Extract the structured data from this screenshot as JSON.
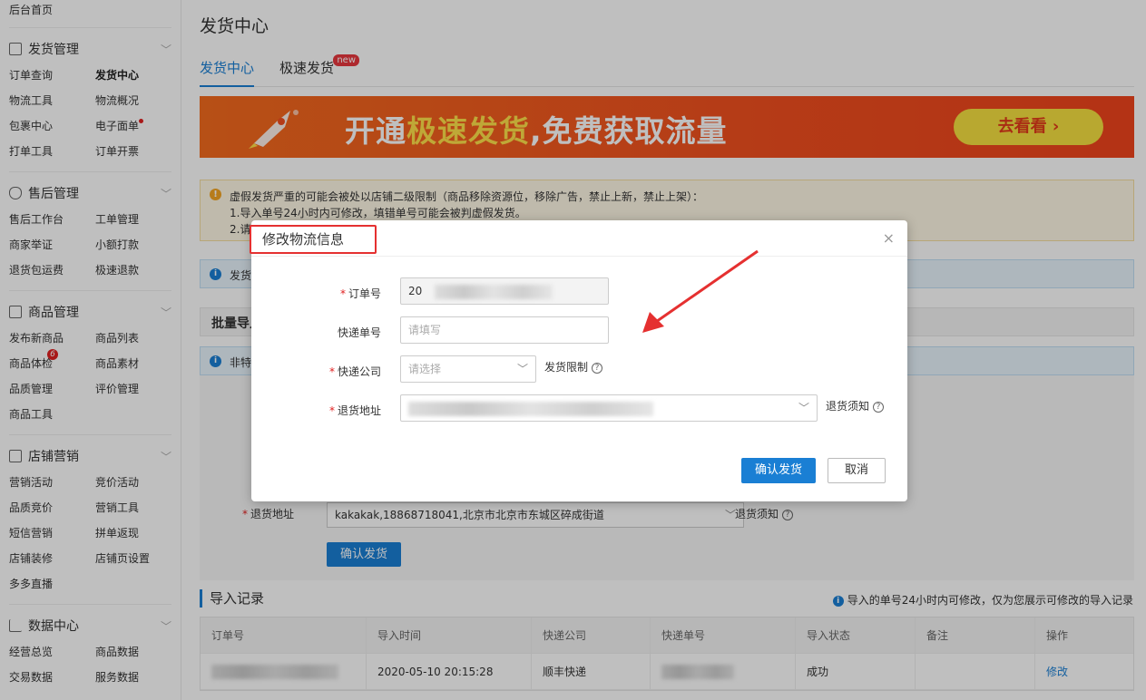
{
  "sidebar": {
    "top_item": "后台首页",
    "sections": [
      {
        "title": "发货管理",
        "items": [
          "订单查询",
          "发货中心",
          "物流工具",
          "物流概况",
          "包裹中心",
          "电子面单",
          "打单工具",
          "订单开票"
        ]
      },
      {
        "title": "售后管理",
        "items": [
          "售后工作台",
          "工单管理",
          "商家举证",
          "小额打款",
          "退货包运费",
          "极速退款"
        ]
      },
      {
        "title": "商品管理",
        "items": [
          "发布新商品",
          "商品列表",
          "商品体检",
          "商品素材",
          "品质管理",
          "评价管理",
          "商品工具"
        ],
        "badge": "6"
      },
      {
        "title": "店铺营销",
        "items": [
          "营销活动",
          "竞价活动",
          "品质竞价",
          "营销工具",
          "短信营销",
          "拼单返现",
          "店铺装修",
          "店铺页设置",
          "多多直播"
        ]
      },
      {
        "title": "数据中心",
        "items": [
          "经营总览",
          "商品数据",
          "交易数据",
          "服务数据"
        ]
      }
    ]
  },
  "page": {
    "title": "发货中心",
    "tabs": [
      "发货中心",
      "极速发货"
    ],
    "new_tag": "new"
  },
  "banner": {
    "text_a": "开通",
    "text_b": "极速发货",
    "text_c": ",免费获取流量",
    "button": "去看看 ›"
  },
  "warning": {
    "line1": "虚假发货严重的可能会被处以店铺二级限制（商品移除资源位，移除广告，禁止上新，禁止上架）：",
    "line2": "1.导入单号24小时内可修改，填错单号可能会被判虚假发货。",
    "line3": "2.请"
  },
  "info_bars": {
    "first": "发货",
    "second": "非特"
  },
  "batch_import": "批量导入",
  "bg_form": {
    "address_label": "退货地址",
    "address_value": "kakakak,18868718041,北京市北京市东城区碎成街道",
    "address_help": "退货须知",
    "confirm": "确认发货"
  },
  "records": {
    "title": "导入记录",
    "note": "导入的单号24小时内可修改，仅为您展示可修改的导入记录",
    "columns": [
      "订单号",
      "导入时间",
      "快递公司",
      "快递单号",
      "导入状态",
      "备注",
      "操作"
    ],
    "rows": [
      {
        "order": "",
        "time": "2020-05-10 20:15:28",
        "company": "顺丰快递",
        "tracking": "",
        "status": "成功",
        "remark": "",
        "action": "修改"
      }
    ]
  },
  "modal": {
    "title": "修改物流信息",
    "close": "×",
    "order_label": "订单号",
    "order_value": "20",
    "tracking_label": "快递单号",
    "tracking_placeholder": "请填写",
    "company_label": "快递公司",
    "company_placeholder": "请选择",
    "company_help": "发货限制",
    "address_label": "退货地址",
    "address_help": "退货须知",
    "confirm": "确认发货",
    "cancel": "取消"
  },
  "colors": {
    "accent": "#1a7fd4",
    "annotation": "#e53030",
    "banner": "#f24f1f"
  }
}
